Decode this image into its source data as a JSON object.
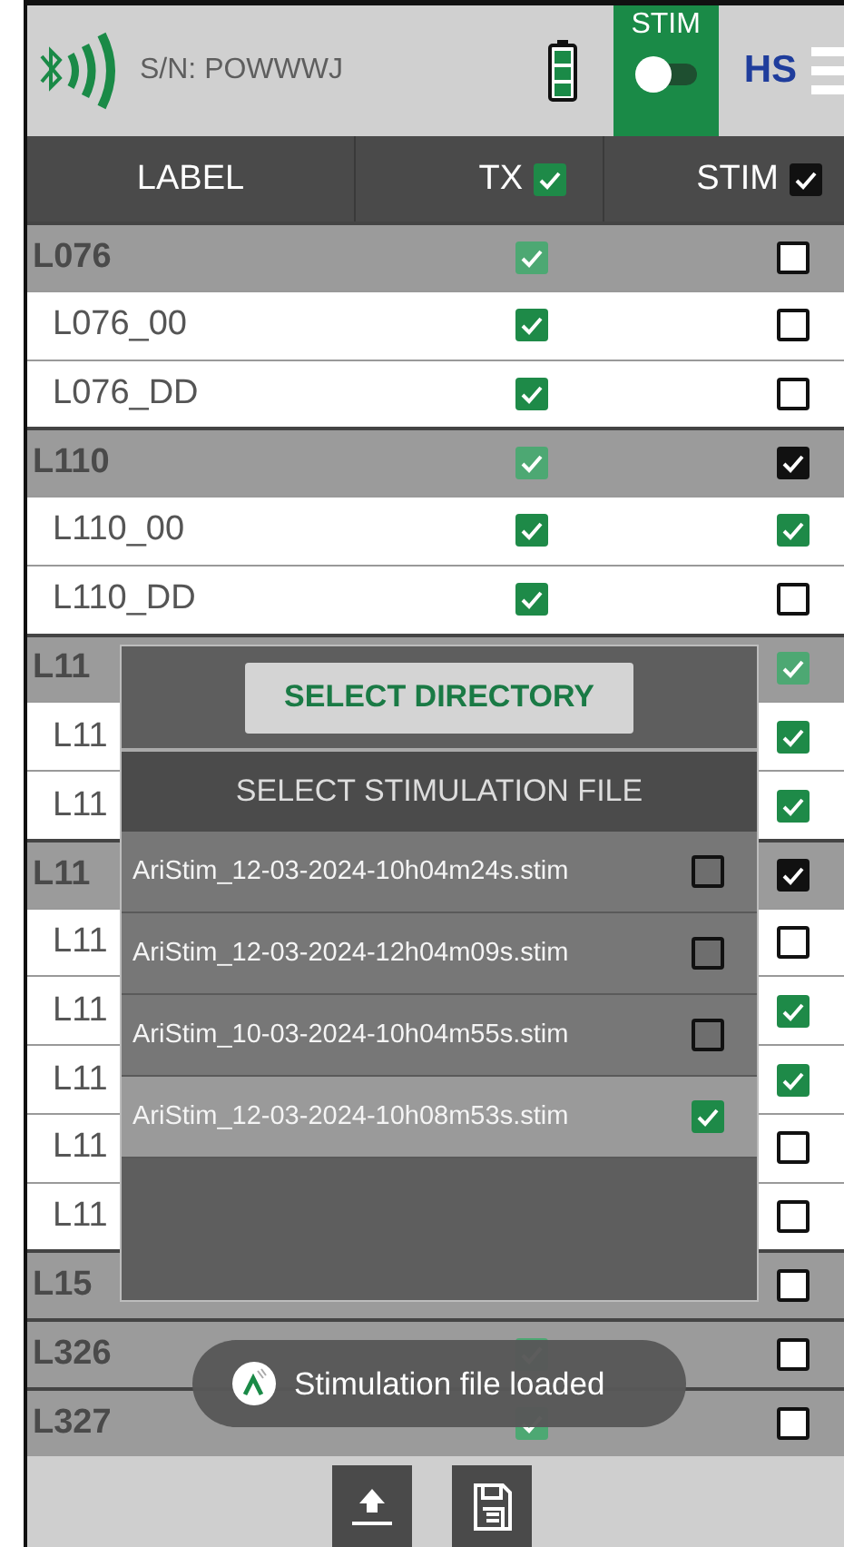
{
  "top_bar": {
    "serial": "S/N: POWWWJ",
    "stim_toggle": {
      "label": "STIM",
      "on": false
    },
    "mode": "HS"
  },
  "columns": [
    {
      "label": "LABEL"
    },
    {
      "label": "TX",
      "checked": true
    },
    {
      "label": "STIM",
      "checked": true,
      "color": "#111111"
    }
  ],
  "rows": [
    {
      "kind": "group",
      "label": "L076",
      "tx": true,
      "stim": {
        "checked": false
      }
    },
    {
      "kind": "item",
      "label": "L076_00",
      "tx": true,
      "stim": {
        "checked": false
      }
    },
    {
      "kind": "item",
      "label": "L076_DD",
      "tx": true,
      "stim": {
        "checked": false
      }
    },
    {
      "kind": "group",
      "label": "L110",
      "tx": true,
      "stim": {
        "checked": true,
        "color": "#111111"
      }
    },
    {
      "kind": "item",
      "label": "L110_00",
      "tx": true,
      "stim": {
        "checked": true
      }
    },
    {
      "kind": "item",
      "label": "L110_DD",
      "tx": true,
      "stim": {
        "checked": false
      }
    },
    {
      "kind": "group",
      "label": "L11",
      "stim": {
        "checked": true
      }
    },
    {
      "kind": "item",
      "label": "L11",
      "stim": {
        "checked": true
      }
    },
    {
      "kind": "item",
      "label": "L11",
      "stim": {
        "checked": true
      }
    },
    {
      "kind": "group",
      "label": "L11",
      "stim": {
        "checked": true,
        "color": "#111111"
      }
    },
    {
      "kind": "item",
      "label": "L11",
      "stim": {
        "checked": false
      }
    },
    {
      "kind": "item",
      "label": "L11",
      "stim": {
        "checked": true
      }
    },
    {
      "kind": "item",
      "label": "L11",
      "stim": {
        "checked": true
      }
    },
    {
      "kind": "item",
      "label": "L11",
      "stim": {
        "checked": false
      }
    },
    {
      "kind": "item",
      "label": "L11",
      "stim": {
        "checked": false
      }
    },
    {
      "kind": "group",
      "label": "L15",
      "stim": {
        "checked": false
      }
    },
    {
      "kind": "group",
      "label": "L326",
      "tx": true,
      "stim": {
        "checked": false
      }
    },
    {
      "kind": "group",
      "label": "L327",
      "tx": true,
      "stim": {
        "checked": false
      }
    }
  ],
  "dialog": {
    "button": "SELECT DIRECTORY",
    "title": "SELECT STIMULATION FILE",
    "files": [
      {
        "name": "AriStim_12-03-2024-10h04m24s.stim",
        "selected": false
      },
      {
        "name": "AriStim_12-03-2024-12h04m09s.stim",
        "selected": false
      },
      {
        "name": "AriStim_10-03-2024-10h04m55s.stim",
        "selected": false
      },
      {
        "name": "AriStim_12-03-2024-10h08m53s.stim",
        "selected": true
      }
    ]
  },
  "toast": {
    "text": "Stimulation file loaded"
  },
  "bottom_bar": {
    "buttons": [
      {
        "kind": "upload"
      },
      {
        "kind": "save"
      }
    ]
  }
}
